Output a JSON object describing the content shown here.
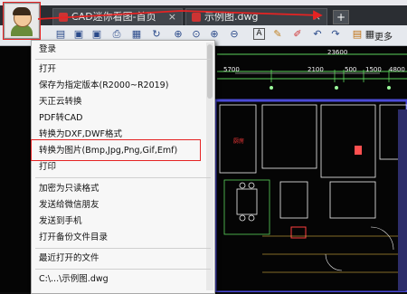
{
  "tabs": [
    {
      "label": "CAD迷你看图-首页"
    },
    {
      "label": "示例图.dwg"
    }
  ],
  "add_tab_label": "+",
  "toolbar": {
    "more_label": "更多"
  },
  "drawing": {
    "top_dims": [
      "23600"
    ],
    "mid_dims": [
      "5700",
      "2100",
      "500",
      "1500",
      "4800"
    ],
    "room_labels": [
      "厨房"
    ]
  },
  "menu": {
    "items": [
      {
        "label": "登录"
      },
      {
        "label": "打开"
      },
      {
        "label": "保存为指定版本(R2000~R2019)"
      },
      {
        "label": "天正云转换"
      },
      {
        "label": "PDF转CAD"
      },
      {
        "label": "转换为DXF,DWF格式"
      },
      {
        "label": "转换为图片(Bmp,Jpg,Png,Gif,Emf)"
      },
      {
        "label": "打印"
      },
      {
        "label": "加密为只读格式"
      },
      {
        "label": "发送给微信朋友"
      },
      {
        "label": "发送到手机"
      },
      {
        "label": "打开备份文件目录"
      },
      {
        "label": "最近打开的文件"
      },
      {
        "label": "C:\\...\\示例图.dwg"
      }
    ]
  },
  "colors": {
    "highlight": "#e52323",
    "accent": "#2a4a8a"
  }
}
